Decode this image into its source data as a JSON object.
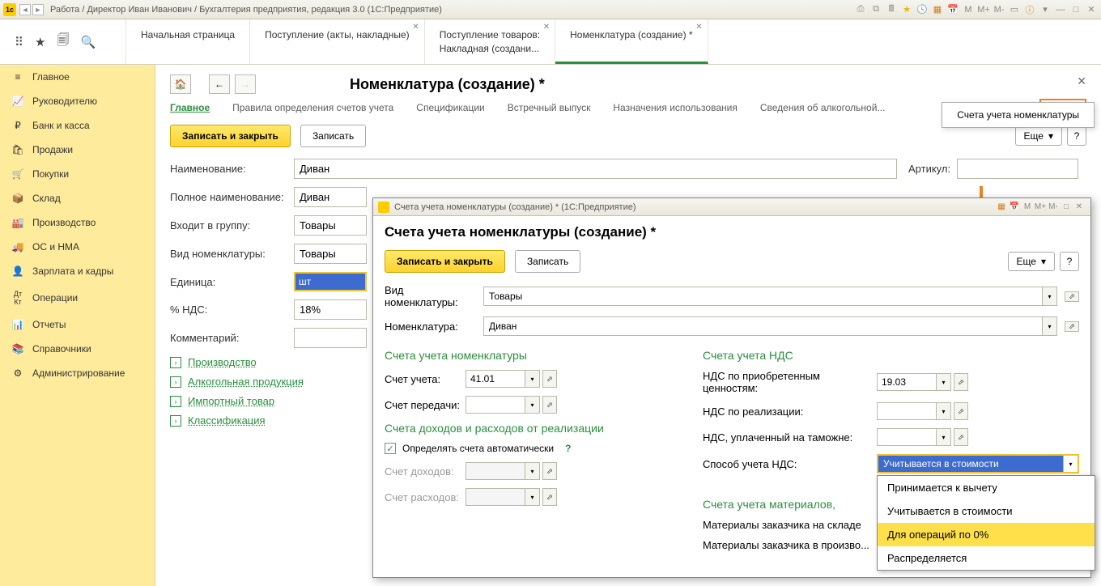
{
  "titlebar": {
    "title": "Работа / Директор Иван Иванович / Бухгалтерия предприятия, редакция 3.0  (1С:Предприятие)",
    "right_icons": [
      "⎙",
      "⧉",
      "★",
      "☰",
      "▦",
      "31",
      "M",
      "M+",
      "M-",
      "▭",
      "ⓘ",
      "▾",
      "—",
      "□",
      "✕"
    ]
  },
  "tabs": [
    {
      "label": "Начальная страница",
      "closable": false
    },
    {
      "label": "Поступление (акты, накладные)",
      "closable": true
    },
    {
      "label": "Поступление товаров:",
      "subtitle": "Накладная (создани...",
      "closable": true
    },
    {
      "label": "Номенклатура (создание) *",
      "closable": true,
      "active": true
    }
  ],
  "sidebar": [
    {
      "icon": "≡",
      "label": "Главное"
    },
    {
      "icon": "↗",
      "label": "Руководителю"
    },
    {
      "icon": "₽",
      "label": "Банк и касса"
    },
    {
      "icon": "🛍",
      "label": "Продажи"
    },
    {
      "icon": "🛒",
      "label": "Покупки"
    },
    {
      "icon": "📦",
      "label": "Склад"
    },
    {
      "icon": "🏭",
      "label": "Производство"
    },
    {
      "icon": "🚚",
      "label": "ОС и НМА"
    },
    {
      "icon": "👤",
      "label": "Зарплата и кадры"
    },
    {
      "icon": "ᴰᴷ",
      "label": "Операции"
    },
    {
      "icon": "📊",
      "label": "Отчеты"
    },
    {
      "icon": "📚",
      "label": "Справочники"
    },
    {
      "icon": "⚙",
      "label": "Администрирование"
    }
  ],
  "page": {
    "title": "Номенклатура (создание) *",
    "subnav": [
      "Главное",
      "Правила определения счетов учета",
      "Спецификации",
      "Встречный выпуск",
      "Назначения использования",
      "Сведения об алкогольной...",
      "Еще"
    ],
    "tooltip": "Счета учета номенклатуры",
    "save_close": "Записать и закрыть",
    "save": "Записать",
    "more": "Еще",
    "fields": {
      "name_label": "Наименование:",
      "name_val": "Диван",
      "article_label": "Артикул:",
      "article_val": "",
      "fullname_label": "Полное наименование:",
      "fullname_val": "Диван",
      "group_label": "Входит в группу:",
      "group_val": "Товары",
      "type_label": "Вид номенклатуры:",
      "type_val": "Товары",
      "unit_label": "Единица:",
      "unit_val": "шт",
      "vat_label": "% НДС:",
      "vat_val": "18%",
      "comment_label": "Комментарий:",
      "comment_val": ""
    },
    "links": [
      "Производство",
      "Алкогольная продукция",
      "Импортный товар",
      "Классификация"
    ]
  },
  "popup": {
    "wintitle": "Счета учета номенклатуры (создание) *  (1С:Предприятие)",
    "title": "Счета учета номенклатуры (создание) *",
    "save_close": "Записать и закрыть",
    "save": "Записать",
    "more": "Еще",
    "type_label": "Вид номенклатуры:",
    "type_val": "Товары",
    "nom_label": "Номенклатура:",
    "nom_val": "Диван",
    "sec1": "Счета учета номенклатуры",
    "acct_label": "Счет учета:",
    "acct_val": "41.01",
    "transfer_label": "Счет передачи:",
    "transfer_val": "",
    "sec2": "Счета доходов и расходов от реализации",
    "auto_label": "Определять счета автоматически",
    "income_label": "Счет доходов:",
    "income_val": "",
    "expense_label": "Счет расходов:",
    "expense_val": "",
    "sec_nds": "Счета учета НДС",
    "nds_buy_label": "НДС по приобретенным ценностям:",
    "nds_buy_val": "19.03",
    "nds_sell_label": "НДС по реализации:",
    "nds_sell_val": "",
    "nds_customs_label": "НДС, уплаченный на таможне:",
    "nds_customs_val": "",
    "nds_way_label": "Способ учета НДС:",
    "nds_way_val": "Учитывается в стоимости",
    "nds_options": [
      "Принимается к вычету",
      "Учитывается в стоимости",
      "Для операций по 0%",
      "Распределяется"
    ],
    "sec_mat": "Счета учета материалов,",
    "mat1_label": "Материалы заказчика на складе",
    "mat2_label": "Материалы заказчика в произво..."
  }
}
